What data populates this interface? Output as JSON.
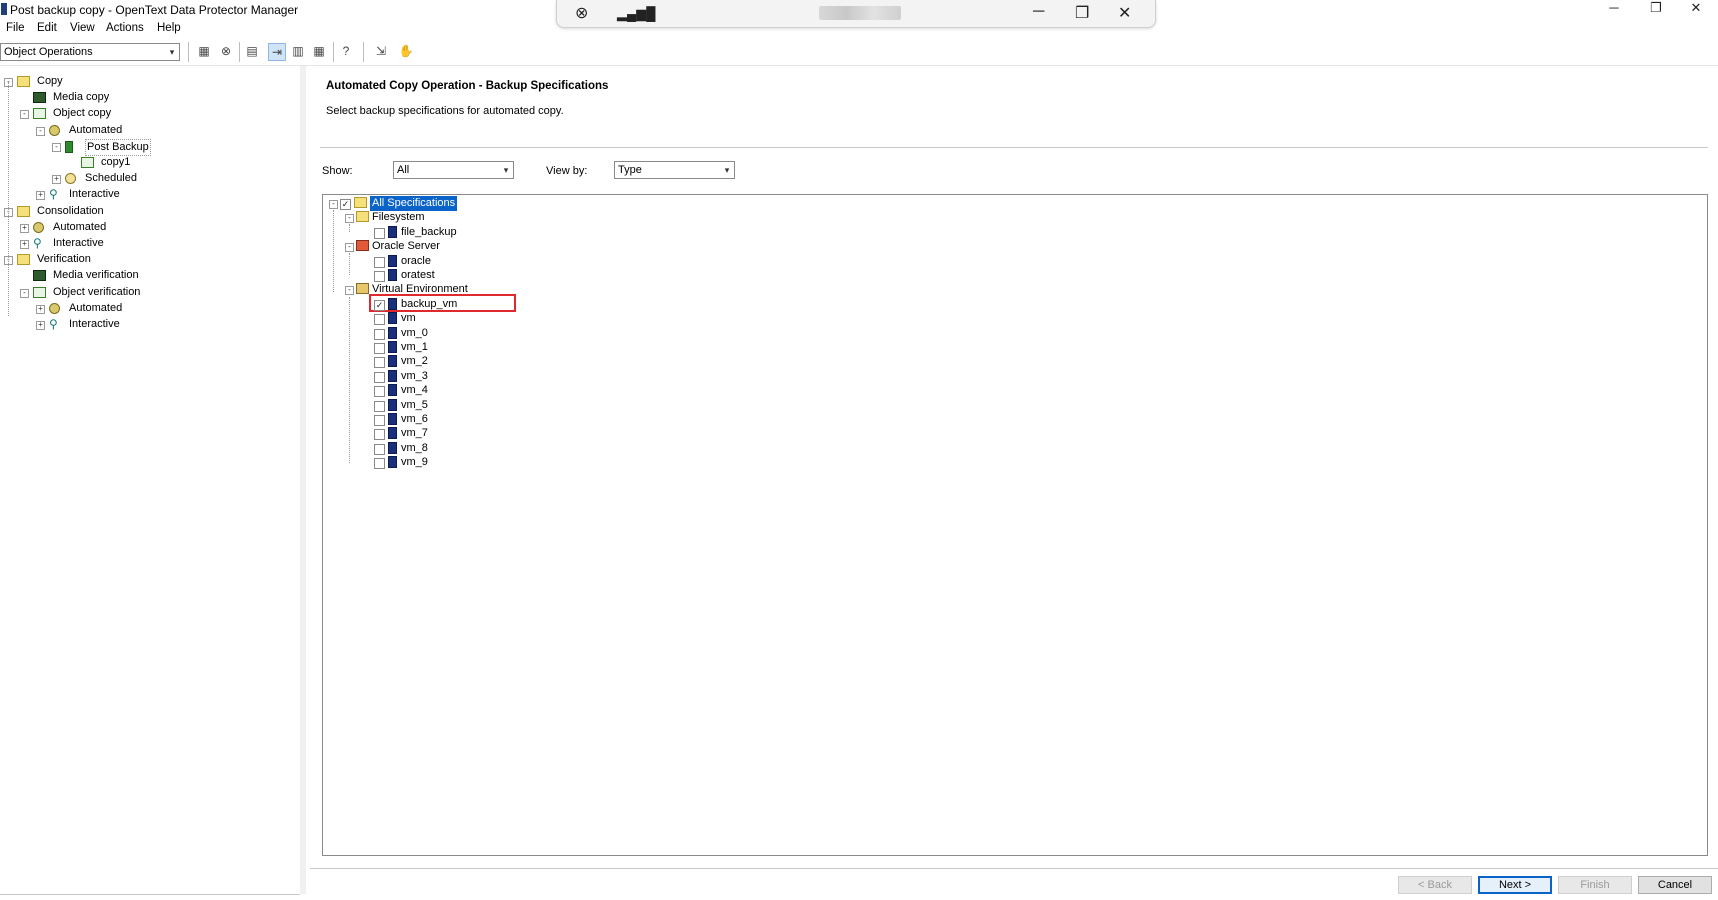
{
  "window": {
    "title": "Post backup copy - OpenText Data Protector Manager",
    "minimize": "─",
    "restore": "❐",
    "close": "✕"
  },
  "remote_bar": {
    "pin": "⊗",
    "signal": "▂▄▆█",
    "minimize": "─",
    "restore": "❐",
    "close": "✕"
  },
  "menu": [
    "File",
    "Edit",
    "View",
    "Actions",
    "Help"
  ],
  "toolbar": {
    "context_selector": "Object Operations",
    "help": "?"
  },
  "left_tree": [
    {
      "label": "Copy",
      "level": 0,
      "icon": "folder",
      "exp": "-"
    },
    {
      "label": "Media copy",
      "level": 1,
      "icon": "media",
      "exp": ""
    },
    {
      "label": "Object copy",
      "level": 1,
      "icon": "object",
      "exp": "-"
    },
    {
      "label": "Automated",
      "level": 2,
      "icon": "gear",
      "exp": "-"
    },
    {
      "label": "Post Backup",
      "level": 3,
      "icon": "green",
      "exp": "-"
    },
    {
      "label": "copy1",
      "level": 4,
      "icon": "object",
      "exp": ""
    },
    {
      "label": "Scheduled",
      "level": 3,
      "icon": "clock",
      "exp": "+"
    },
    {
      "label": "Interactive",
      "level": 2,
      "icon": "run",
      "exp": "+"
    },
    {
      "label": "Consolidation",
      "level": 0,
      "icon": "folder",
      "exp": "-"
    },
    {
      "label": "Automated",
      "level": 1,
      "icon": "gear",
      "exp": "+"
    },
    {
      "label": "Interactive",
      "level": 1,
      "icon": "run",
      "exp": "+"
    },
    {
      "label": "Verification",
      "level": 0,
      "icon": "folder",
      "exp": "-"
    },
    {
      "label": "Media verification",
      "level": 1,
      "icon": "media",
      "exp": ""
    },
    {
      "label": "Object verification",
      "level": 1,
      "icon": "object",
      "exp": "-"
    },
    {
      "label": "Automated",
      "level": 2,
      "icon": "gear",
      "exp": "+"
    },
    {
      "label": "Interactive",
      "level": 2,
      "icon": "run",
      "exp": "+"
    }
  ],
  "wizard": {
    "heading": "Automated Copy Operation - Backup Specifications",
    "subheading": "Select backup specifications for automated copy.",
    "show_label": "Show:",
    "show_value": "All",
    "viewby_label": "View by:",
    "viewby_value": "Type"
  },
  "spec_tree": [
    {
      "label": "All Specifications",
      "level": 0,
      "icon": "folder",
      "checked": true,
      "selected": true,
      "exp": "-"
    },
    {
      "label": "Filesystem",
      "level": 1,
      "icon": "folder",
      "checked": null,
      "exp": "-"
    },
    {
      "label": "file_backup",
      "level": 2,
      "icon": "script",
      "checked": false
    },
    {
      "label": "Oracle Server",
      "level": 1,
      "icon": "oracle",
      "checked": null,
      "exp": "-"
    },
    {
      "label": "oracle",
      "level": 2,
      "icon": "script",
      "checked": false
    },
    {
      "label": "oratest",
      "level": 2,
      "icon": "script",
      "checked": false
    },
    {
      "label": "Virtual Environment",
      "level": 1,
      "icon": "ve",
      "checked": null,
      "exp": "-"
    },
    {
      "label": "backup_vm",
      "level": 2,
      "icon": "script",
      "checked": true
    },
    {
      "label": "vm",
      "level": 2,
      "icon": "script",
      "checked": false
    },
    {
      "label": "vm_0",
      "level": 2,
      "icon": "script",
      "checked": false
    },
    {
      "label": "vm_1",
      "level": 2,
      "icon": "script",
      "checked": false
    },
    {
      "label": "vm_2",
      "level": 2,
      "icon": "script",
      "checked": false
    },
    {
      "label": "vm_3",
      "level": 2,
      "icon": "script",
      "checked": false
    },
    {
      "label": "vm_4",
      "level": 2,
      "icon": "script",
      "checked": false
    },
    {
      "label": "vm_5",
      "level": 2,
      "icon": "script",
      "checked": false
    },
    {
      "label": "vm_6",
      "level": 2,
      "icon": "script",
      "checked": false
    },
    {
      "label": "vm_7",
      "level": 2,
      "icon": "script",
      "checked": false
    },
    {
      "label": "vm_8",
      "level": 2,
      "icon": "script",
      "checked": false
    },
    {
      "label": "vm_9",
      "level": 2,
      "icon": "script",
      "checked": false
    }
  ],
  "buttons": {
    "back": "< Back",
    "next": "Next >",
    "finish": "Finish",
    "cancel": "Cancel"
  },
  "colors": {
    "selection": "#0a63c9",
    "highlight_box": "#e0282d"
  }
}
